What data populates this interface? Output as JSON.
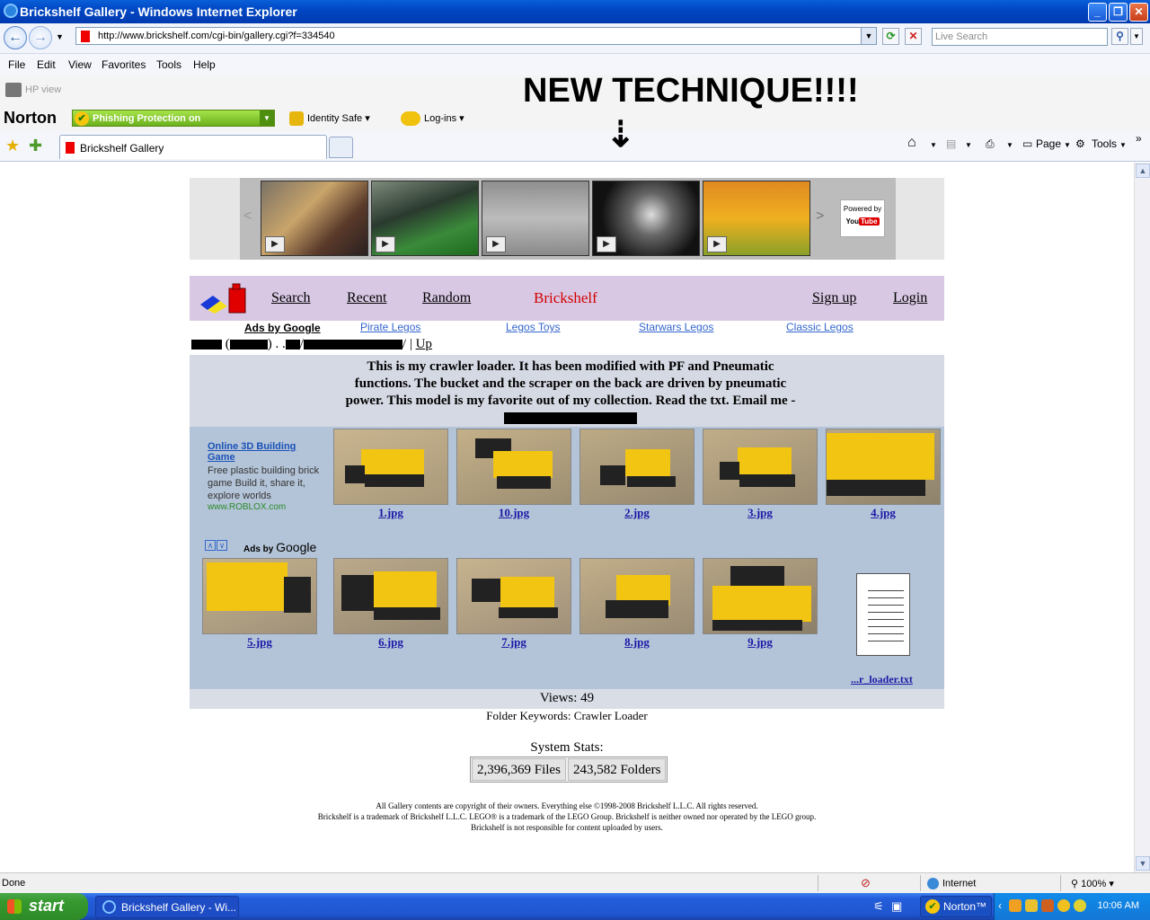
{
  "window": {
    "title": "Brickshelf Gallery - Windows Internet Explorer",
    "minimize": "_",
    "maximize": "❐",
    "close": "✕"
  },
  "address": {
    "url": "http://www.brickshelf.com/cgi-bin/gallery.cgi?f=334540",
    "search_placeholder": "Live Search"
  },
  "menu": [
    "File",
    "Edit",
    "View",
    "Favorites",
    "Tools",
    "Help"
  ],
  "hp": {
    "label": "HP view"
  },
  "annotation": {
    "text": "NEW TECHNIQUE!!!!",
    "arrow": "➘"
  },
  "norton": {
    "logo": "Norton",
    "phishing": "Phishing Protection on",
    "identity_safe": "Identity Safe",
    "logins": "Log-ins"
  },
  "tab": {
    "title": "Brickshelf Gallery"
  },
  "toolbar": {
    "page": "Page",
    "tools": "Tools"
  },
  "youtube": {
    "powered_by": "Powered by",
    "you": "You",
    "tube": "Tube"
  },
  "brickshelf_nav": {
    "search": "Search",
    "recent": "Recent",
    "random": "Random",
    "brand": "Brickshelf",
    "signup": "Sign up",
    "login": "Login"
  },
  "ads_row": {
    "ads_by": "Ads by Google",
    "links": [
      "Pirate Legos",
      "Legos Toys",
      "Starwars Legos",
      "Classic Legos"
    ]
  },
  "breadcrumb": {
    "dots": ". .",
    "up": "Up"
  },
  "description": "This is my crawler loader. It has been modified with PF and Pneumatic functions. The bucket and the scraper on the back are driven by pneumatic power. This model is my favorite out of my collection. Read the txt. Email me -",
  "left_ad": {
    "title": "Online 3D Building Game",
    "body": "Free plastic building brick game Build it, share it, explore worlds",
    "url": "www.ROBLOX.com",
    "ads_by": "Ads by",
    "google": "Google",
    "up": "∧",
    "down": "∨"
  },
  "gallery": {
    "row1": [
      "1.jpg",
      "10.jpg",
      "2.jpg",
      "3.jpg",
      "4.jpg"
    ],
    "row2": [
      "5.jpg",
      "6.jpg",
      "7.jpg",
      "8.jpg",
      "9.jpg"
    ],
    "txt_file": "...r_loader.txt"
  },
  "views": "Views: 49",
  "keywords": "Folder Keywords: Crawler Loader",
  "stats": {
    "label": "System Stats:",
    "files": "2,396,369 Files",
    "folders": "243,582 Folders"
  },
  "copyright": [
    "All Gallery contents are copyright of their owners. Everything else ©1998-2008 Brickshelf L.L.C. All rights reserved.",
    "Brickshelf is a trademark of Brickshelf L.L.C. LEGO® is a trademark of the LEGO Group. Brickshelf is neither owned nor operated by the LEGO group.",
    "Brickshelf is not responsible for content uploaded by users."
  ],
  "status": {
    "left": "Done",
    "zone": "Internet",
    "zoom": "100%"
  },
  "taskbar": {
    "start": "start",
    "task": "Brickshelf Gallery - Wi...",
    "norton": "Norton™",
    "time": "10:06 AM"
  },
  "colors": {
    "brand_red": "#d40000",
    "nav_bg": "#d8c8e4",
    "gallery_bg": "#b4c4d8",
    "link_blue": "#1a1aa6"
  }
}
